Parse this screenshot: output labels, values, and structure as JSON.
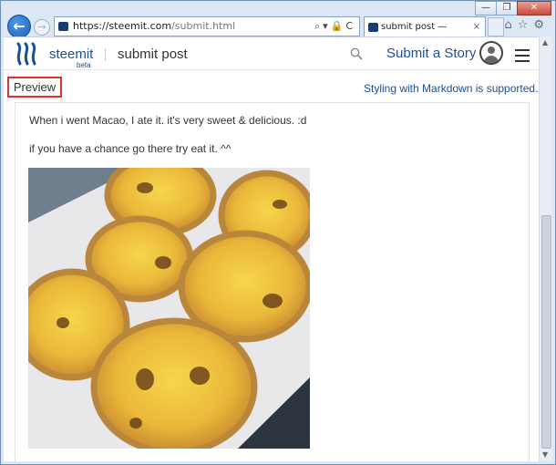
{
  "browser": {
    "url_domain": "https://steemit.com",
    "url_path": "/submit.html",
    "tab_title": "submit post — Steemit",
    "tab_close": "×",
    "window_buttons": {
      "minimize": "—",
      "restore": "❐",
      "close": "✕"
    },
    "address_tools": "⌕▾🔒C",
    "right_icons": "⌂☆⚙"
  },
  "header": {
    "brand": "steemit",
    "beta": "beta",
    "page_title": "submit post",
    "submit_story": "Submit a Story"
  },
  "editor": {
    "preview_label": "Preview",
    "markdown_note": "Styling with Markdown is supported."
  },
  "post": {
    "paragraph1": "When i went Macao, I ate it. it's very sweet & delicious. :d",
    "paragraph2": "if you have a chance go there try eat it. ^^"
  },
  "colors": {
    "accent": "#1a5099",
    "preview_border": "#e0302b"
  }
}
